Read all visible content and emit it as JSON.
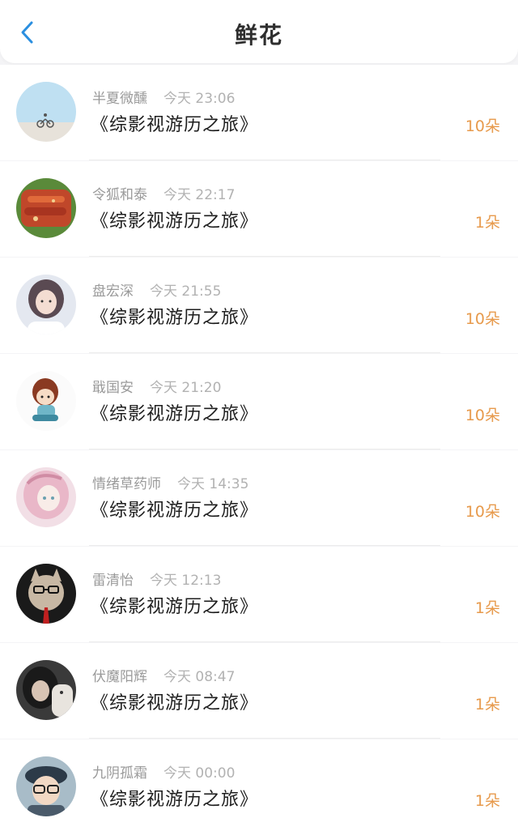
{
  "header": {
    "title": "鲜花",
    "back_icon": "chevron-left-icon",
    "accent_color": "#2b8fe0"
  },
  "count_color": "#e79a4c",
  "items": [
    {
      "user": "半夏微醺",
      "time": "今天 23:06",
      "book": "《综影视游历之旅》",
      "count": "10朵"
    },
    {
      "user": "令狐和泰",
      "time": "今天 22:17",
      "book": "《综影视游历之旅》",
      "count": "1朵"
    },
    {
      "user": "盘宏深",
      "time": "今天 21:55",
      "book": "《综影视游历之旅》",
      "count": "10朵"
    },
    {
      "user": "戢国安",
      "time": "今天 21:20",
      "book": "《综影视游历之旅》",
      "count": "10朵"
    },
    {
      "user": "情绪草药师",
      "time": "今天 14:35",
      "book": "《综影视游历之旅》",
      "count": "10朵"
    },
    {
      "user": "雷清怡",
      "time": "今天 12:13",
      "book": "《综影视游历之旅》",
      "count": "1朵"
    },
    {
      "user": "伏魔阳辉",
      "time": "今天 08:47",
      "book": "《综影视游历之旅》",
      "count": "1朵"
    },
    {
      "user": "九阴孤霜",
      "time": "今天 00:00",
      "book": "《综影视游历之旅》",
      "count": "1朵"
    }
  ]
}
